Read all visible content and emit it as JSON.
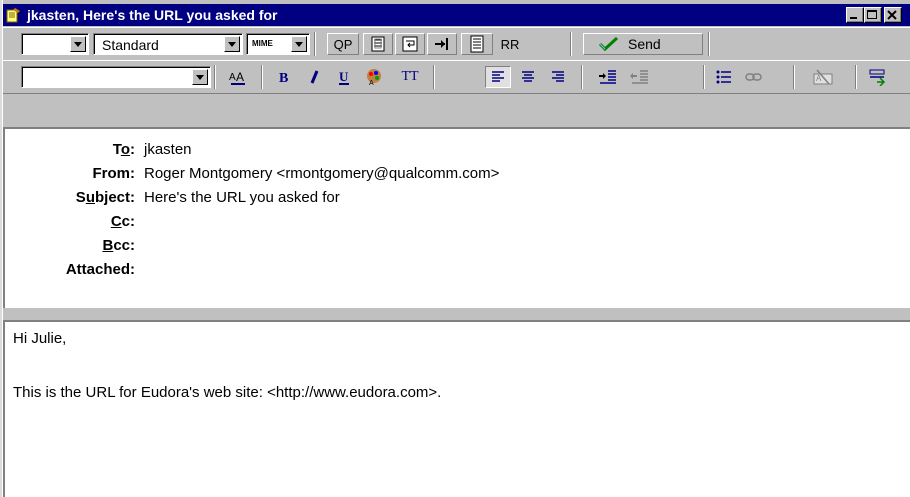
{
  "window": {
    "title": "jkasten, Here's the URL you asked for"
  },
  "toolbar1": {
    "priority_value": "",
    "signature_value": "Standard",
    "mime_label": "MIME",
    "qp_label": "QP",
    "rr_label": "RR",
    "send_label": "Send"
  },
  "toolbar2": {
    "font_value": "",
    "tt_label": "TT"
  },
  "headers": {
    "to": {
      "label_pre": "T",
      "label_ul": "o",
      "label_post": ":",
      "value": "jkasten"
    },
    "from": {
      "label": "From:",
      "value": "Roger Montgomery <rmontgomery@qualcomm.com>"
    },
    "subject": {
      "label_pre": "S",
      "label_ul": "u",
      "label_post": "bject:",
      "value": "Here's the URL you asked for"
    },
    "cc": {
      "label_ul": "C",
      "label_post": "c:",
      "value": ""
    },
    "bcc": {
      "label_ul": "B",
      "label_post": "cc:",
      "value": ""
    },
    "attached": {
      "label": "Attached:",
      "value": ""
    }
  },
  "message": {
    "greeting": "Hi Julie,",
    "line1": "This is the URL for Eudora's web site: <http://www.eudora.com>."
  },
  "colors": {
    "titlebar": "#000080",
    "chrome": "#c0c0c0"
  }
}
